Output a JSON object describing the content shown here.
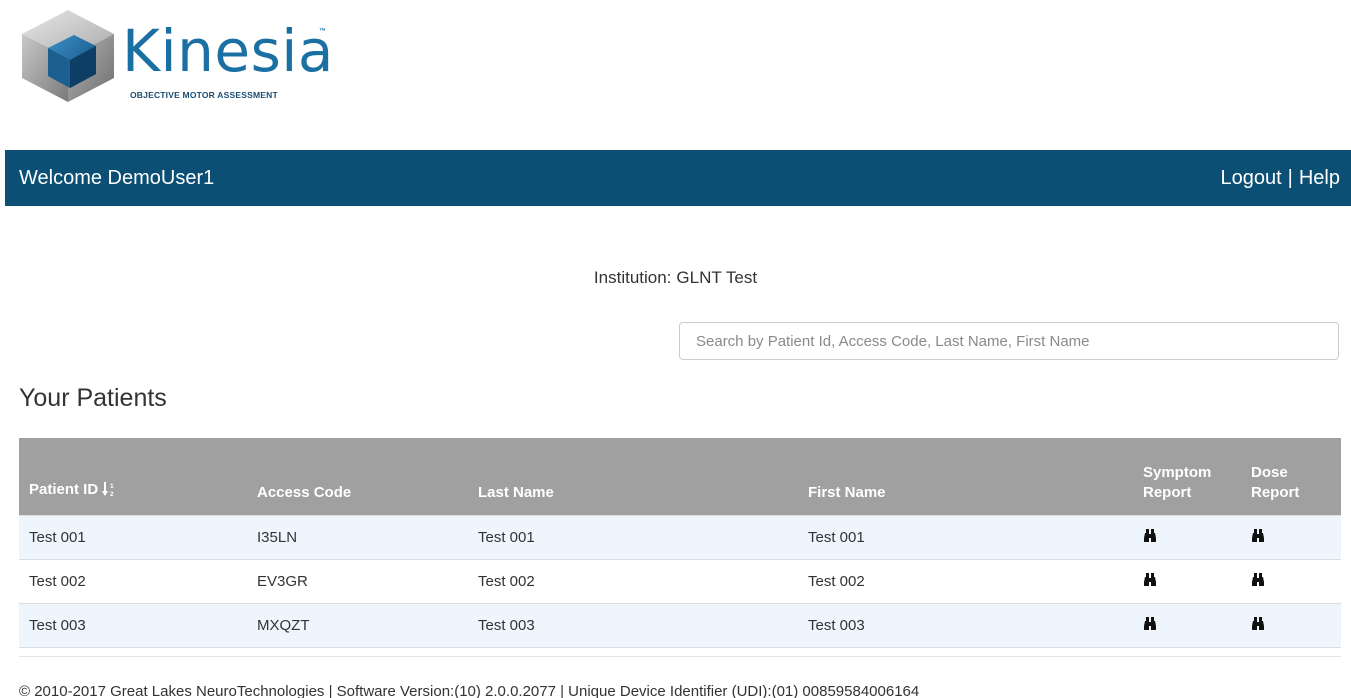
{
  "brand": {
    "name": "Kinesia",
    "trademark": "™",
    "tagline": "OBJECTIVE MOTOR ASSESSMENT",
    "colors": {
      "blue": "#1a6fa3",
      "navy": "#0b4f75"
    }
  },
  "header": {
    "welcome": "Welcome DemoUser1",
    "logout": "Logout",
    "separator": "|",
    "help": "Help"
  },
  "institution": {
    "label": "Institution:",
    "value": "GLNT Test"
  },
  "search": {
    "placeholder": "Search by Patient Id, Access Code, Last Name, First Name",
    "value": ""
  },
  "patients": {
    "title": "Your Patients",
    "columns": {
      "patient_id": "Patient ID",
      "access_code": "Access Code",
      "last_name": "Last Name",
      "first_name": "First Name",
      "symptom_report": [
        "Symptom",
        "Report"
      ],
      "dose_report": [
        "Dose",
        "Report"
      ]
    },
    "sort_icon": "sort-numeric-asc-icon",
    "report_icon": "binoculars-icon",
    "rows": [
      {
        "patient_id": "Test 001",
        "access_code": "I35LN",
        "last_name": "Test 001",
        "first_name": "Test 001"
      },
      {
        "patient_id": "Test 002",
        "access_code": "EV3GR",
        "last_name": "Test 002",
        "first_name": "Test 002"
      },
      {
        "patient_id": "Test 003",
        "access_code": "MXQZT",
        "last_name": "Test 003",
        "first_name": "Test 003"
      }
    ]
  },
  "footer": {
    "text": "© 2010-2017 Great Lakes NeuroTechnologies | Software Version:(10) 2.0.0.2077 | Unique Device Identifier (UDI):(01) 00859584006164"
  }
}
